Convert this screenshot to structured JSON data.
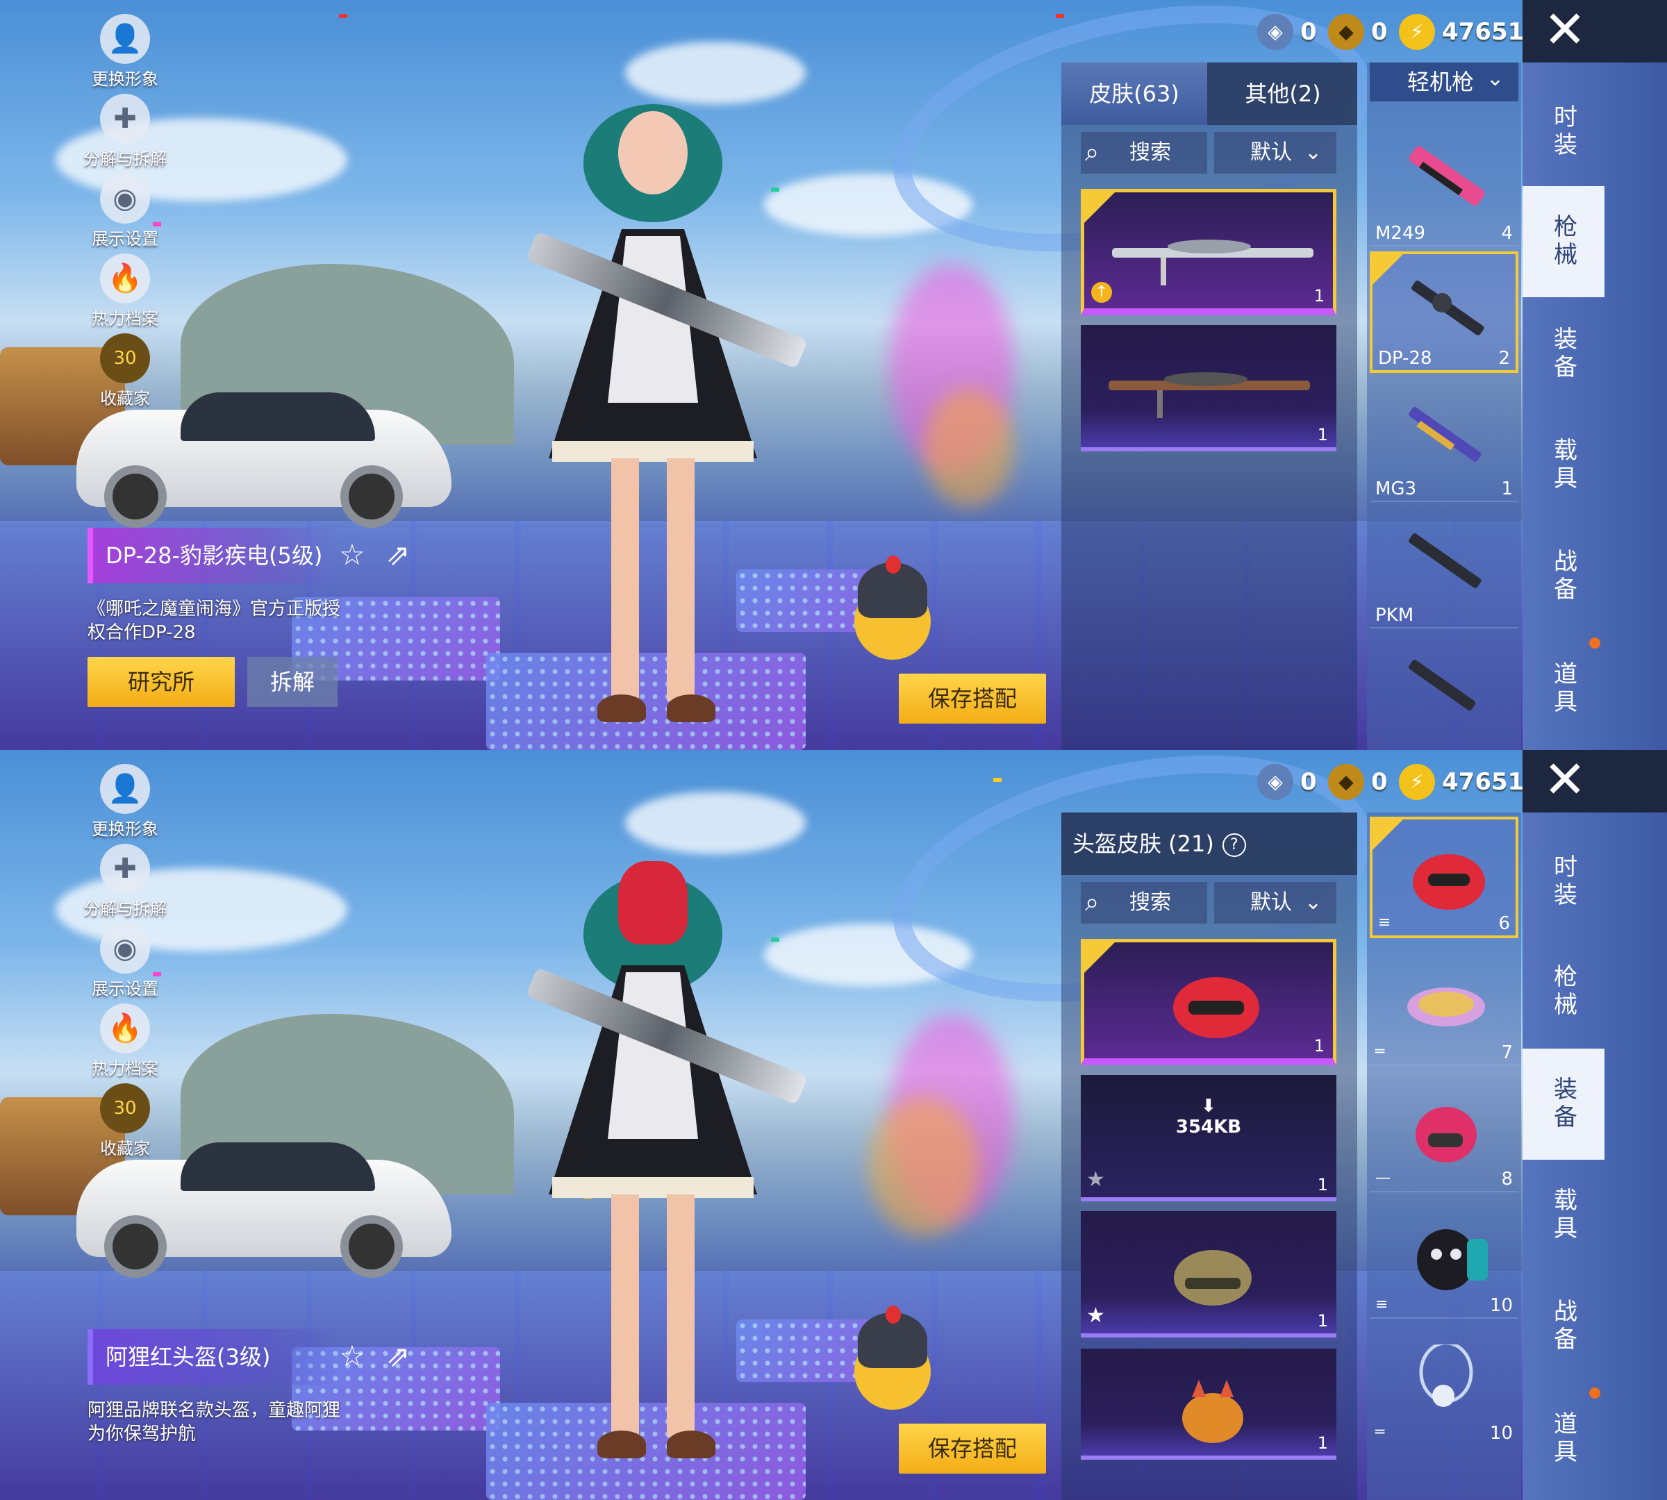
{
  "currency": {
    "items": [
      {
        "icon": "blue-coupon-icon",
        "value": "0"
      },
      {
        "icon": "gold-badge-icon",
        "value": "0"
      },
      {
        "icon": "lightning-coin-icon",
        "value": "47651"
      }
    ]
  },
  "left_menu": [
    {
      "icon": "avatar-icon",
      "label": "更换形象"
    },
    {
      "icon": "puzzle-icon",
      "label": "分解与拆解"
    },
    {
      "icon": "eye-icon",
      "label": "展示设置"
    },
    {
      "icon": "fire-icon",
      "label": "热力档案"
    },
    {
      "icon": "collector-badge-icon",
      "label": "收藏家",
      "badge": "30"
    }
  ],
  "category_tabs": [
    "时装",
    "枪械",
    "装备",
    "载具",
    "战备",
    "道具"
  ],
  "save_button": "保存搭配",
  "screen1": {
    "active_category": "枪械",
    "item_title": "DP-28-豹影疾电(5级)",
    "item_desc": "《哪吒之魔童闹海》官方正版授权合作DP-28",
    "research_button": "研究所",
    "dismantle_button": "拆解",
    "tabs": [
      {
        "label": "皮肤(63)",
        "active": true
      },
      {
        "label": "其他(2)",
        "active": false
      }
    ],
    "search_placeholder": "搜索",
    "sort_label": "默认",
    "weapon_dropdown": "轻机枪",
    "skins": [
      {
        "count": "1",
        "selected": true,
        "badge": "upgrade"
      },
      {
        "count": "1",
        "selected": false
      }
    ],
    "weapons": [
      {
        "name": "M249",
        "count": "4",
        "selected": false
      },
      {
        "name": "DP-28",
        "count": "2",
        "selected": true
      },
      {
        "name": "MG3",
        "count": "1",
        "selected": false
      },
      {
        "name": "PKM",
        "count": "",
        "selected": false
      },
      {
        "name": "",
        "count": "",
        "selected": false
      }
    ]
  },
  "screen2": {
    "active_category": "装备",
    "item_title": "阿狸红头盔(3级)",
    "item_desc": "阿狸品牌联名款头盔，童趣阿狸为你保驾护航",
    "header_label": "头盔皮肤 (21)",
    "help_icon": "?",
    "search_placeholder": "搜索",
    "sort_label": "默认",
    "skins": [
      {
        "count": "1",
        "selected": true,
        "badge": ""
      },
      {
        "count": "1",
        "selected": false,
        "badge": "star",
        "download": "354KB"
      },
      {
        "count": "1",
        "selected": false,
        "badge": "star-filled"
      },
      {
        "count": "1",
        "selected": false,
        "badge": ""
      }
    ],
    "equipment": [
      {
        "count": "6",
        "selected": true
      },
      {
        "count": "7",
        "selected": false
      },
      {
        "count": "8",
        "selected": false
      },
      {
        "count": "10",
        "selected": false
      },
      {
        "count": "10",
        "selected": false
      }
    ]
  },
  "colors": {
    "accent_yellow": "#f6c936",
    "purple_title": "#c659ff",
    "rail_blue": "#4a67b2"
  }
}
